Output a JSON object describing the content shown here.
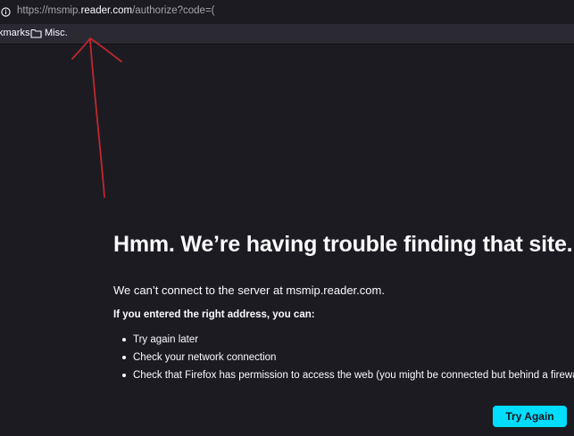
{
  "url_bar": {
    "url_prefix": "https://msmip.",
    "url_domain": "reader.com",
    "url_suffix": "/authorize?code=("
  },
  "bookmarks_bar": {
    "items": [
      {
        "label": "kmarks",
        "icon": "none"
      },
      {
        "label": "Misc.",
        "icon": "folder-icon"
      }
    ]
  },
  "error_page": {
    "title": "Hmm. We’re having trouble finding that site.",
    "description": "We can’t connect to the server at msmip.reader.com.",
    "suggestions_heading": "If you entered the right address, you can:",
    "suggestions": [
      "Try again later",
      "Check your network connection",
      "Check that Firefox has permission to access the web (you might be connected but behind a firewall)"
    ],
    "try_again_label": "Try Again"
  },
  "colors": {
    "background": "#1c1b22",
    "toolbar": "#2b2a33",
    "accent_button": "#00ddff",
    "annotation_arrow": "#c0282d"
  }
}
